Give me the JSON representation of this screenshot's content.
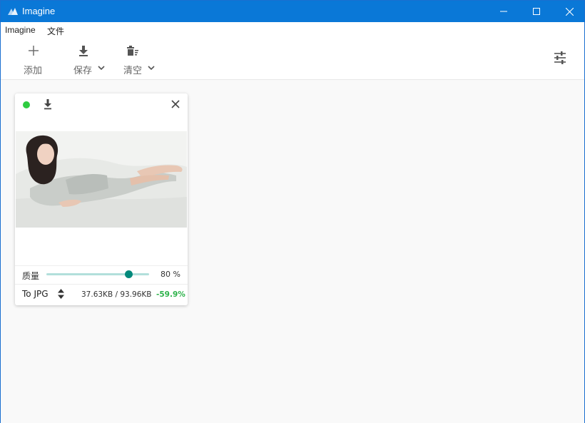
{
  "window": {
    "title": "Imagine",
    "accent_color": "#0a78d7",
    "controls": [
      "minimize-icon",
      "maximize-icon",
      "close-icon"
    ]
  },
  "menu": {
    "items": [
      "Imagine",
      "文件"
    ]
  },
  "toolbar": {
    "add_label": "添加",
    "save_label": "保存",
    "clear_label": "清空",
    "icons": [
      "plus-icon",
      "download-icon",
      "trash-icon",
      "sliders-icon"
    ]
  },
  "card": {
    "status_color": "#2ecc40",
    "quality_label": "质量",
    "quality_value": "80 %",
    "quality_fraction": 0.8,
    "format_label": "To JPG",
    "sizes": "37.63KB / 93.96KB",
    "reduction": "-59.9%",
    "reduction_color": "#2db24a"
  }
}
